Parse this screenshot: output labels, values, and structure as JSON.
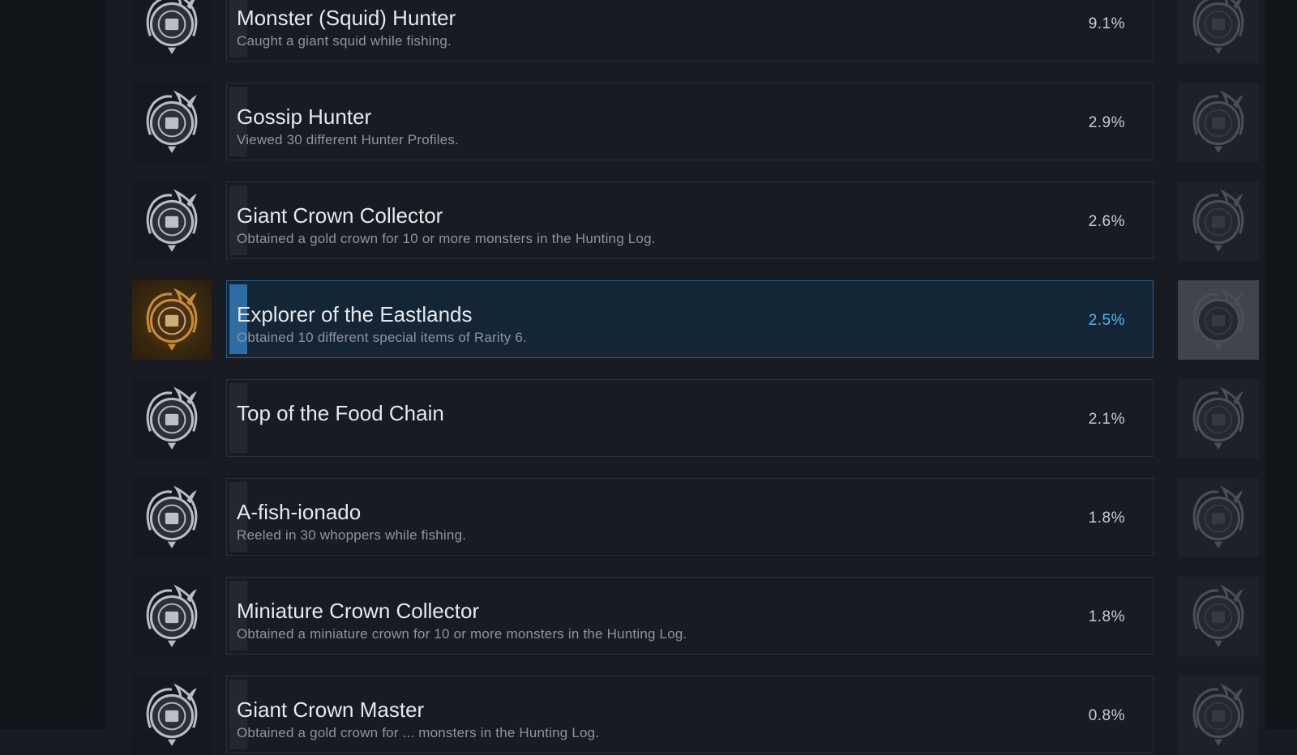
{
  "achievements": [
    {
      "title": "Monster (Squid) Hunter",
      "description": "Caught a giant squid while fishing.",
      "percent": "9.1%",
      "icon": "squid-emblem-icon",
      "highlighted": false
    },
    {
      "title": "Gossip Hunter",
      "description": "Viewed 30 different Hunter Profiles.",
      "percent": "2.9%",
      "icon": "profile-card-emblem-icon",
      "highlighted": false
    },
    {
      "title": "Giant Crown Collector",
      "description": "Obtained a gold crown for 10 or more monsters in the Hunting Log.",
      "percent": "2.6%",
      "icon": "crown-emblem-icon",
      "highlighted": false
    },
    {
      "title": "Explorer of the Eastlands",
      "description": "Obtained 10 different special items of Rarity 6.",
      "percent": "2.5%",
      "icon": "scroll-emblem-icon",
      "highlighted": true
    },
    {
      "title": "Top of the Food Chain",
      "description": "",
      "percent": "2.1%",
      "icon": "food-chain-emblem-icon",
      "highlighted": false
    },
    {
      "title": "A-fish-ionado",
      "description": "Reeled in 30 whoppers while fishing.",
      "percent": "1.8%",
      "icon": "fish-emblem-icon",
      "highlighted": false
    },
    {
      "title": "Miniature Crown Collector",
      "description": "Obtained a miniature crown for 10 or more monsters in the Hunting Log.",
      "percent": "1.8%",
      "icon": "mini-crown-emblem-icon",
      "highlighted": false
    },
    {
      "title": "Giant Crown Master",
      "description": "Obtained a gold crown for ... monsters in the Hunting Log.",
      "percent": "0.8%",
      "icon": "crown-master-emblem-icon",
      "highlighted": false
    }
  ],
  "colors": {
    "highlight_accent": "#2d6da3",
    "highlight_percent": "#58b5ee",
    "highlight_icon_bg": "#6a4a1c"
  }
}
